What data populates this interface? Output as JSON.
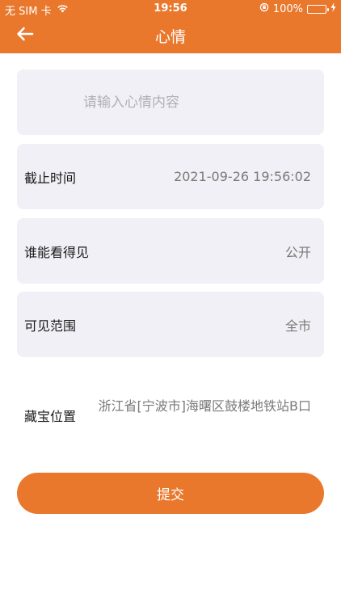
{
  "status_bar": {
    "carrier": "无 SIM 卡",
    "time": "19:56",
    "battery": "100%",
    "battery_level": 1.0
  },
  "nav": {
    "title": "心情"
  },
  "form": {
    "mood_placeholder": "请输入心情内容",
    "mood_value": "",
    "deadline_label": "截止时间",
    "deadline_value": "2021-09-26 19:56:02",
    "visibility_label": "谁能看得见",
    "visibility_value": "公开",
    "range_label": "可见范围",
    "range_value": "全市",
    "location_label": "藏宝位置",
    "location_value": "浙江省[宁波市]海曙区鼓楼地铁站B口"
  },
  "actions": {
    "submit_label": "提交"
  },
  "colors": {
    "accent": "#E9782D",
    "card_bg": "#F1F0F6",
    "battery": "#5BE05B"
  }
}
